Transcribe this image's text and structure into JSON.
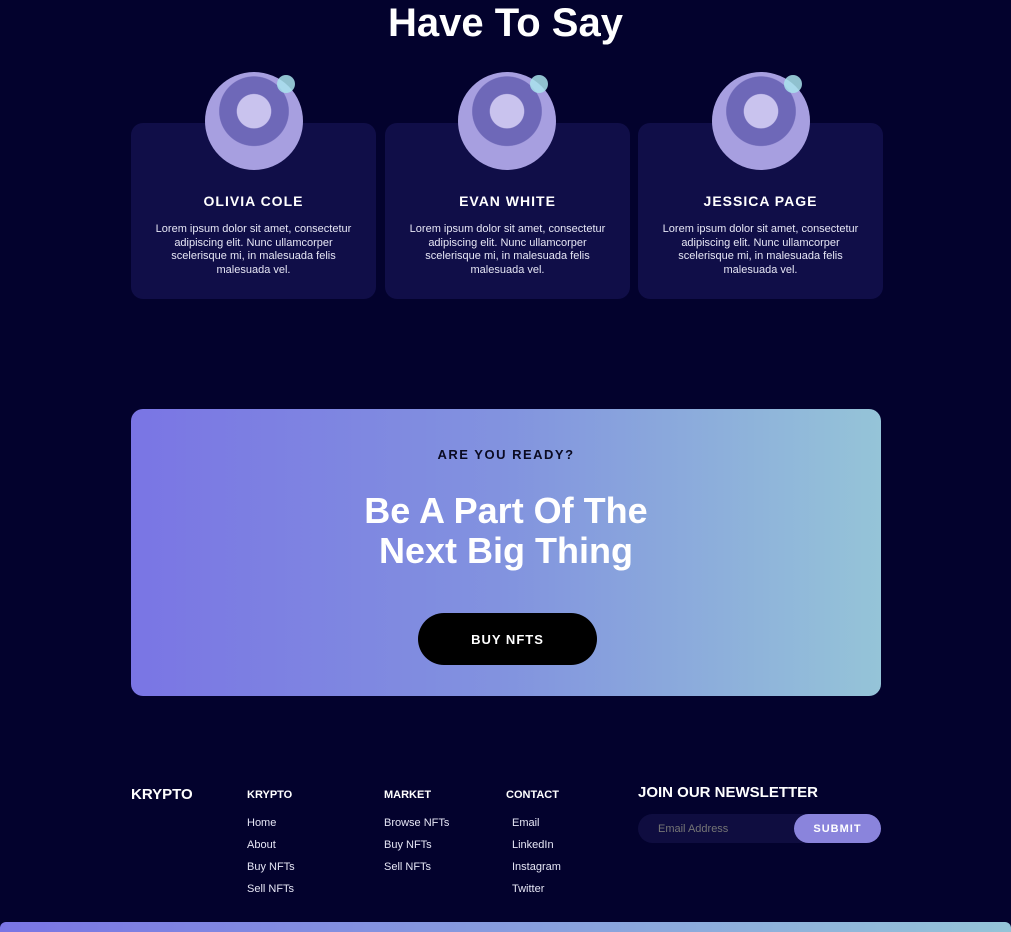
{
  "heading": "Have To Say",
  "testimonials": [
    {
      "name": "OLIVIA COLE",
      "quote": "Lorem ipsum dolor sit amet, consectetur adipiscing elit. Nunc ullamcorper scelerisque mi, in malesuada felis malesuada vel."
    },
    {
      "name": "EVAN WHITE",
      "quote": "Lorem ipsum dolor sit amet, consectetur adipiscing elit. Nunc ullamcorper scelerisque mi, in malesuada felis malesuada vel."
    },
    {
      "name": "JESSICA PAGE",
      "quote": "Lorem ipsum dolor sit amet, consectetur adipiscing elit. Nunc ullamcorper scelerisque mi, in malesuada felis malesuada vel."
    }
  ],
  "cta": {
    "kicker": "ARE YOU READY?",
    "line1": "Be A Part Of The",
    "line2": "Next Big Thing",
    "button": "BUY NFTS"
  },
  "footer": {
    "brand": "KRYPTO",
    "columns": [
      {
        "title": "KRYPTO",
        "links": [
          "Home",
          "About",
          "Buy NFTs",
          "Sell NFTs"
        ]
      },
      {
        "title": "MARKET",
        "links": [
          "Browse NFTs",
          "Buy NFTs",
          "Sell NFTs"
        ]
      },
      {
        "title": "CONTACT",
        "links": [
          "Email",
          "LinkedIn",
          "Instagram",
          "Twitter"
        ]
      }
    ],
    "newsletter": {
      "title": "JOIN OUR NEWSLETTER",
      "placeholder": "Email Address",
      "submit": "SUBMIT"
    }
  }
}
